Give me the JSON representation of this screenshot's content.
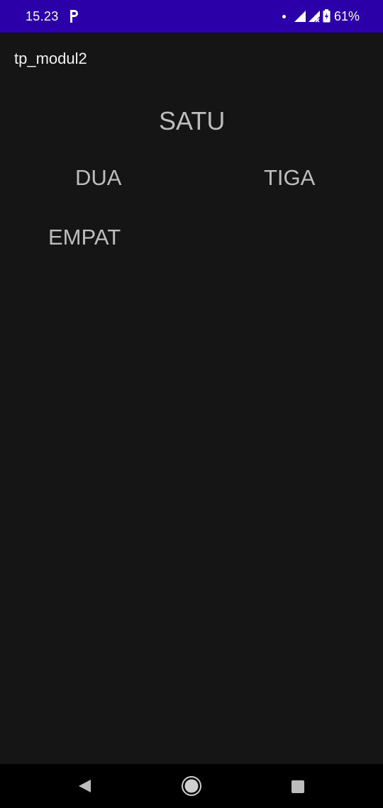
{
  "status_bar": {
    "time": "15.23",
    "battery": "61%",
    "icons": [
      "parking-icon",
      "notification-dot-icon",
      "signal-icon",
      "signal-no-data-icon",
      "battery-icon"
    ]
  },
  "app_bar": {
    "title": "tp_modul2"
  },
  "main": {
    "labels": {
      "satu": "SATU",
      "dua": "DUA",
      "tiga": "TIGA",
      "empat": "EMPAT"
    }
  },
  "nav_bar": {
    "icons": [
      "back-icon",
      "home-icon",
      "recents-icon"
    ]
  },
  "colors": {
    "status_bar": "#2c00a8",
    "background": "#151515",
    "label_text": "#bdbdbd",
    "nav_bar": "#000000"
  }
}
